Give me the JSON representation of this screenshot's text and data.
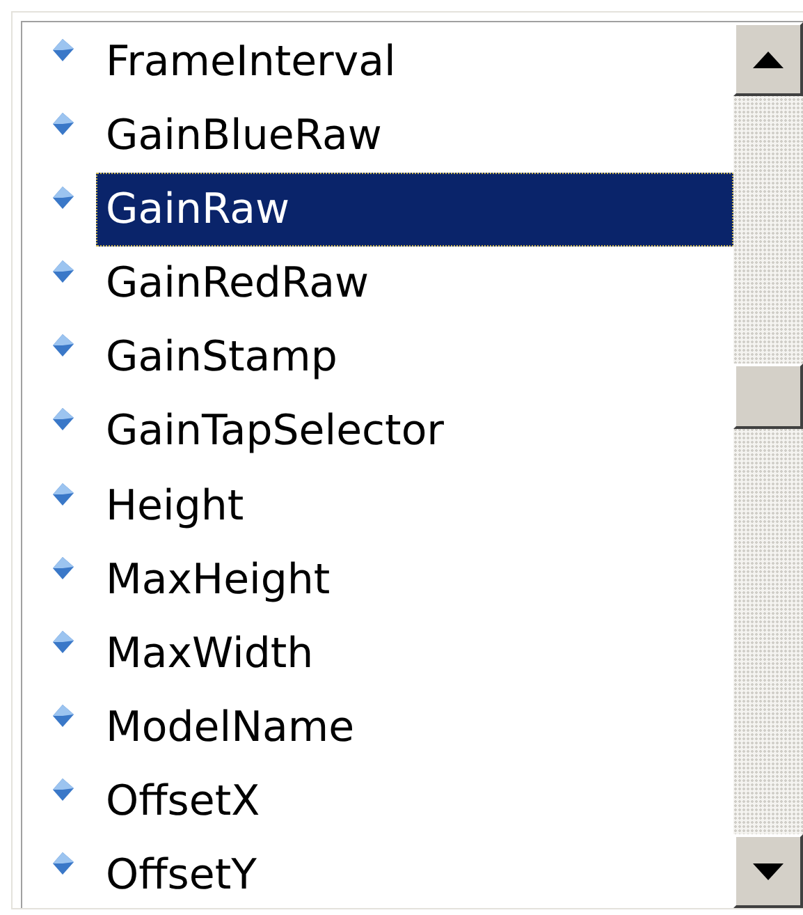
{
  "list": {
    "items": [
      {
        "label": "FrameInterval",
        "selected": false
      },
      {
        "label": "GainBlueRaw",
        "selected": false
      },
      {
        "label": "GainRaw",
        "selected": true
      },
      {
        "label": "GainRedRaw",
        "selected": false
      },
      {
        "label": "GainStamp",
        "selected": false
      },
      {
        "label": "GainTapSelector",
        "selected": false
      },
      {
        "label": "Height",
        "selected": false
      },
      {
        "label": "MaxHeight",
        "selected": false
      },
      {
        "label": "MaxWidth",
        "selected": false
      },
      {
        "label": "ModelName",
        "selected": false
      },
      {
        "label": "OffsetX",
        "selected": false
      },
      {
        "label": "OffsetY",
        "selected": false
      }
    ]
  }
}
